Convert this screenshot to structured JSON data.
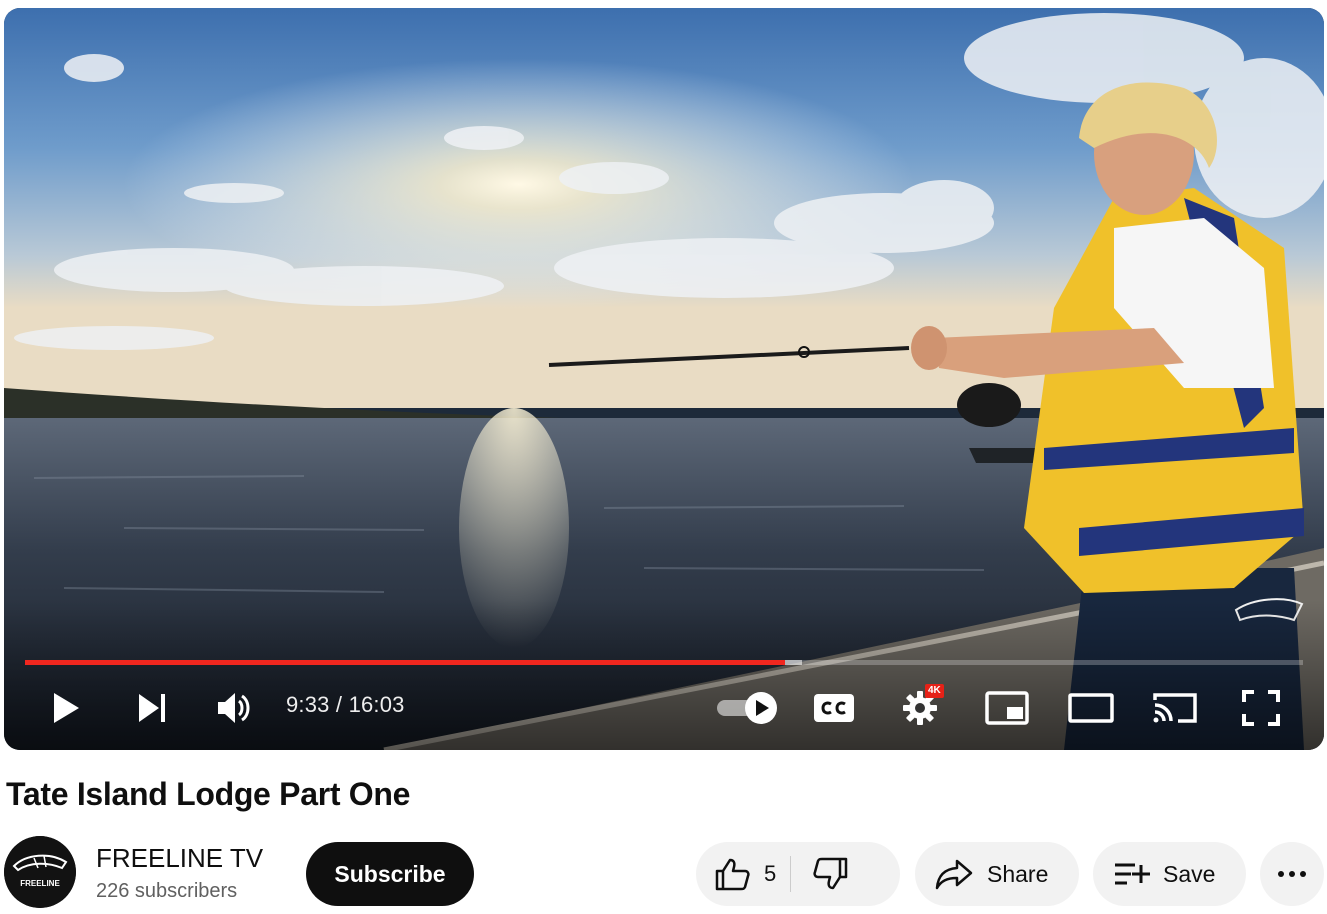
{
  "player": {
    "time_current": "9:33",
    "time_separator": " / ",
    "time_total": "16:03",
    "progress_fraction": 0.595,
    "buffered_fraction": 0.608,
    "quality_badge": "4K",
    "icons": {
      "play": "play-icon",
      "next": "next-icon",
      "volume": "volume-icon",
      "autoplay": "autoplay-toggle-icon",
      "captions": "captions-icon",
      "settings": "settings-icon",
      "miniplayer": "miniplayer-icon",
      "theater": "theater-mode-icon",
      "cast": "cast-icon",
      "fullscreen": "fullscreen-icon"
    },
    "accent_color": "#f0271f"
  },
  "video": {
    "title": "Tate Island Lodge Part One"
  },
  "channel": {
    "name": "FREELINE TV",
    "subscribers": "226 subscribers",
    "avatar_text": "FREELINE",
    "subscribe_label": "Subscribe"
  },
  "actions": {
    "like_count": "5",
    "share_label": "Share",
    "save_label": "Save"
  }
}
